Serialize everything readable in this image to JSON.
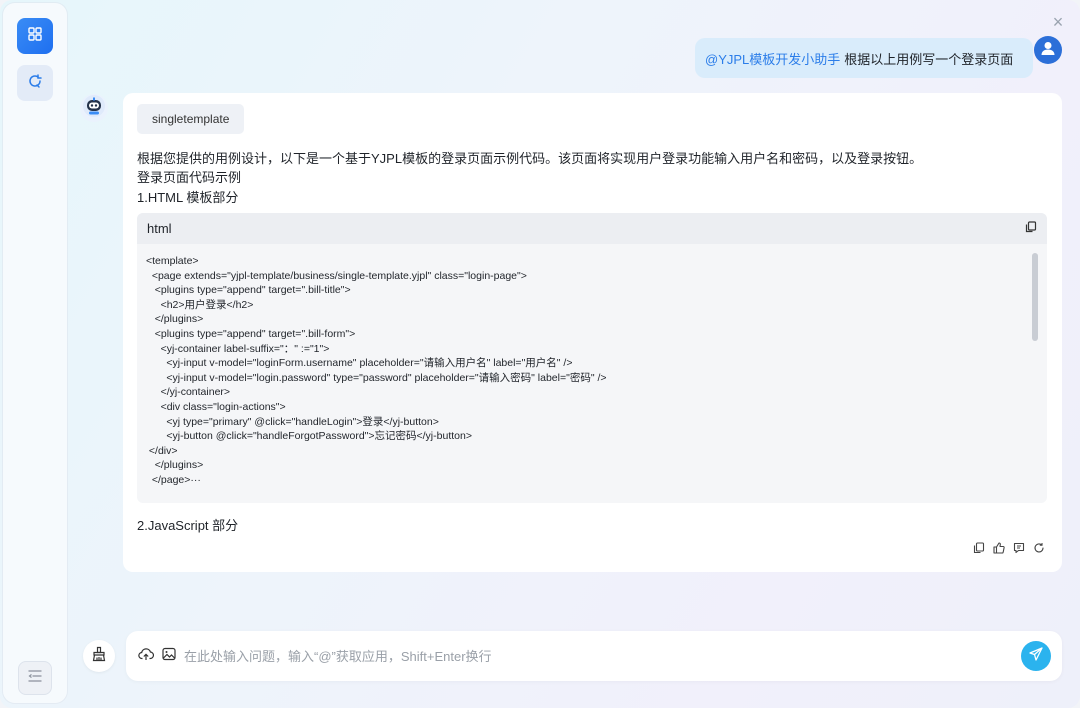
{
  "window": {
    "close_symbol": "×"
  },
  "sidebar": {
    "items": [
      {
        "icon": "apps-grid-icon"
      },
      {
        "icon": "new-chat-icon"
      },
      {
        "icon": "collapse-menu-icon"
      }
    ]
  },
  "user_message": {
    "mention": "@YJPL模板开发小助手",
    "text": "根据以上用例写一个登录页面",
    "avatar_icon": "user-avatar-icon"
  },
  "bot_message": {
    "avatar_icon": "robot-avatar-icon",
    "tag": "singletemplate",
    "intro": "根据您提供的用例设计，以下是一个基于YJPL模板的登录页面示例代码。该页面将实现用户登录功能输入用户名和密码，以及登录按钮。",
    "heading": "登录页面代码示例",
    "section1": "1.HTML 模板部分",
    "section2": "2.JavaScript 部分",
    "code": {
      "lang": "html",
      "lines": [
        "<template>",
        "  <page extends=\"yjpl-template/business/single-template.yjpl\" class=\"login-page\">",
        "   <plugins type=\"append\" target=\".bill-title\">",
        "     <h2>用户登录</h2>",
        "   </plugins>",
        "   <plugins type=\"append\" target=\".bill-form\">",
        "     <yj-container label-suffix=\"：\" :=\"1\">",
        "       <yj-input v-model=\"loginForm.username\" placeholder=\"请输入用户名\" label=\"用户名\" />",
        "       <yj-input v-model=\"login.password\" type=\"password\" placeholder=\"请输入密码\" label=\"密码\" />",
        "     </yj-container>",
        "     <div class=\"login-actions\">",
        "       <yj type=\"primary\" @click=\"handleLogin\">登录</yj-button>",
        "       <yj-button @click=\"handleForgotPassword\">忘记密码</yj-button>",
        " </div>",
        "   </plugins>",
        "  </page>···"
      ]
    },
    "actions": [
      "copy-icon",
      "thumbs-up-icon",
      "feedback-icon",
      "regenerate-icon"
    ]
  },
  "composer": {
    "placeholder": "在此处输入问题，输入“@”获取应用，Shift+Enter换行",
    "value": ""
  },
  "colors": {
    "accent": "#2b7de9",
    "send_button": "#2bb3ee",
    "user_bubble": "#d9ecfb"
  }
}
